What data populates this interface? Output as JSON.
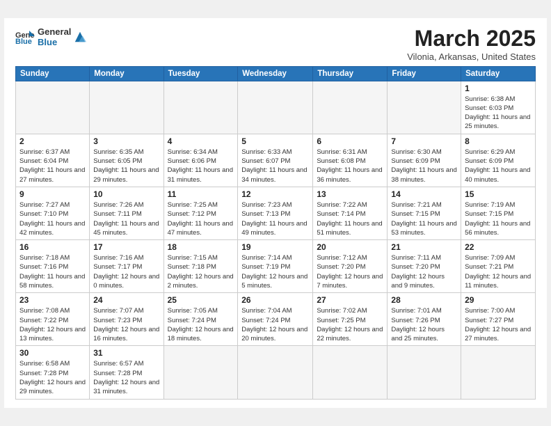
{
  "logo": {
    "line1": "General",
    "line2": "Blue"
  },
  "title": "March 2025",
  "subtitle": "Vilonia, Arkansas, United States",
  "headers": [
    "Sunday",
    "Monday",
    "Tuesday",
    "Wednesday",
    "Thursday",
    "Friday",
    "Saturday"
  ],
  "weeks": [
    [
      {
        "day": "",
        "info": ""
      },
      {
        "day": "",
        "info": ""
      },
      {
        "day": "",
        "info": ""
      },
      {
        "day": "",
        "info": ""
      },
      {
        "day": "",
        "info": ""
      },
      {
        "day": "",
        "info": ""
      },
      {
        "day": "1",
        "info": "Sunrise: 6:38 AM\nSunset: 6:03 PM\nDaylight: 11 hours and 25 minutes."
      }
    ],
    [
      {
        "day": "2",
        "info": "Sunrise: 6:37 AM\nSunset: 6:04 PM\nDaylight: 11 hours and 27 minutes."
      },
      {
        "day": "3",
        "info": "Sunrise: 6:35 AM\nSunset: 6:05 PM\nDaylight: 11 hours and 29 minutes."
      },
      {
        "day": "4",
        "info": "Sunrise: 6:34 AM\nSunset: 6:06 PM\nDaylight: 11 hours and 31 minutes."
      },
      {
        "day": "5",
        "info": "Sunrise: 6:33 AM\nSunset: 6:07 PM\nDaylight: 11 hours and 34 minutes."
      },
      {
        "day": "6",
        "info": "Sunrise: 6:31 AM\nSunset: 6:08 PM\nDaylight: 11 hours and 36 minutes."
      },
      {
        "day": "7",
        "info": "Sunrise: 6:30 AM\nSunset: 6:09 PM\nDaylight: 11 hours and 38 minutes."
      },
      {
        "day": "8",
        "info": "Sunrise: 6:29 AM\nSunset: 6:09 PM\nDaylight: 11 hours and 40 minutes."
      }
    ],
    [
      {
        "day": "9",
        "info": "Sunrise: 7:27 AM\nSunset: 7:10 PM\nDaylight: 11 hours and 42 minutes."
      },
      {
        "day": "10",
        "info": "Sunrise: 7:26 AM\nSunset: 7:11 PM\nDaylight: 11 hours and 45 minutes."
      },
      {
        "day": "11",
        "info": "Sunrise: 7:25 AM\nSunset: 7:12 PM\nDaylight: 11 hours and 47 minutes."
      },
      {
        "day": "12",
        "info": "Sunrise: 7:23 AM\nSunset: 7:13 PM\nDaylight: 11 hours and 49 minutes."
      },
      {
        "day": "13",
        "info": "Sunrise: 7:22 AM\nSunset: 7:14 PM\nDaylight: 11 hours and 51 minutes."
      },
      {
        "day": "14",
        "info": "Sunrise: 7:21 AM\nSunset: 7:15 PM\nDaylight: 11 hours and 53 minutes."
      },
      {
        "day": "15",
        "info": "Sunrise: 7:19 AM\nSunset: 7:15 PM\nDaylight: 11 hours and 56 minutes."
      }
    ],
    [
      {
        "day": "16",
        "info": "Sunrise: 7:18 AM\nSunset: 7:16 PM\nDaylight: 11 hours and 58 minutes."
      },
      {
        "day": "17",
        "info": "Sunrise: 7:16 AM\nSunset: 7:17 PM\nDaylight: 12 hours and 0 minutes."
      },
      {
        "day": "18",
        "info": "Sunrise: 7:15 AM\nSunset: 7:18 PM\nDaylight: 12 hours and 2 minutes."
      },
      {
        "day": "19",
        "info": "Sunrise: 7:14 AM\nSunset: 7:19 PM\nDaylight: 12 hours and 5 minutes."
      },
      {
        "day": "20",
        "info": "Sunrise: 7:12 AM\nSunset: 7:20 PM\nDaylight: 12 hours and 7 minutes."
      },
      {
        "day": "21",
        "info": "Sunrise: 7:11 AM\nSunset: 7:20 PM\nDaylight: 12 hours and 9 minutes."
      },
      {
        "day": "22",
        "info": "Sunrise: 7:09 AM\nSunset: 7:21 PM\nDaylight: 12 hours and 11 minutes."
      }
    ],
    [
      {
        "day": "23",
        "info": "Sunrise: 7:08 AM\nSunset: 7:22 PM\nDaylight: 12 hours and 13 minutes."
      },
      {
        "day": "24",
        "info": "Sunrise: 7:07 AM\nSunset: 7:23 PM\nDaylight: 12 hours and 16 minutes."
      },
      {
        "day": "25",
        "info": "Sunrise: 7:05 AM\nSunset: 7:24 PM\nDaylight: 12 hours and 18 minutes."
      },
      {
        "day": "26",
        "info": "Sunrise: 7:04 AM\nSunset: 7:24 PM\nDaylight: 12 hours and 20 minutes."
      },
      {
        "day": "27",
        "info": "Sunrise: 7:02 AM\nSunset: 7:25 PM\nDaylight: 12 hours and 22 minutes."
      },
      {
        "day": "28",
        "info": "Sunrise: 7:01 AM\nSunset: 7:26 PM\nDaylight: 12 hours and 25 minutes."
      },
      {
        "day": "29",
        "info": "Sunrise: 7:00 AM\nSunset: 7:27 PM\nDaylight: 12 hours and 27 minutes."
      }
    ],
    [
      {
        "day": "30",
        "info": "Sunrise: 6:58 AM\nSunset: 7:28 PM\nDaylight: 12 hours and 29 minutes."
      },
      {
        "day": "31",
        "info": "Sunrise: 6:57 AM\nSunset: 7:28 PM\nDaylight: 12 hours and 31 minutes."
      },
      {
        "day": "",
        "info": ""
      },
      {
        "day": "",
        "info": ""
      },
      {
        "day": "",
        "info": ""
      },
      {
        "day": "",
        "info": ""
      },
      {
        "day": "",
        "info": ""
      }
    ]
  ]
}
